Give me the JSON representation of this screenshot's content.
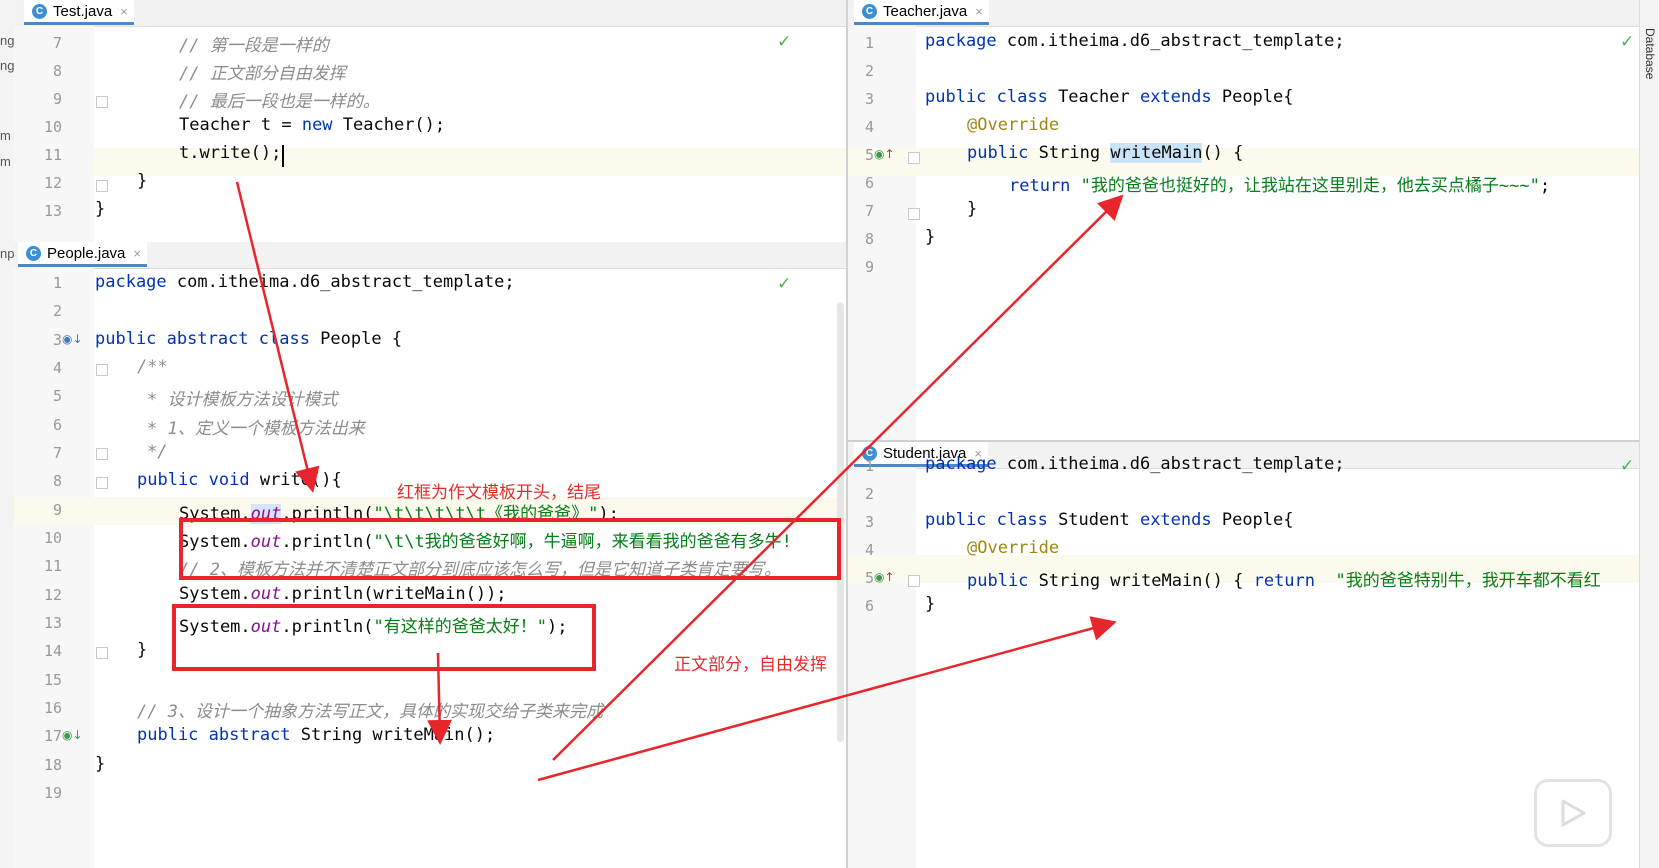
{
  "panes": {
    "test": {
      "tab_label": "Test.java",
      "close": "×",
      "lines": [
        {
          "n": "7",
          "text": "// 第一段是一样的"
        },
        {
          "n": "8",
          "text": "// 正文部分自由发挥"
        },
        {
          "n": "9",
          "text": "// 最后一段也是一样的。"
        },
        {
          "n": "10",
          "a": "Teacher t = ",
          "b": "new",
          "c": " Teacher();"
        },
        {
          "n": "11",
          "text": "t.write();"
        },
        {
          "n": "12",
          "text": "}"
        },
        {
          "n": "13",
          "text": "}"
        }
      ]
    },
    "people": {
      "tab_label": "People.java",
      "close": "×",
      "line_numbers": [
        "1",
        "2",
        "3",
        "4",
        "5",
        "6",
        "7",
        "8",
        "9",
        "10",
        "11",
        "12",
        "13",
        "14",
        "15",
        "16",
        "17",
        "18",
        "19"
      ],
      "l1_kw": "package",
      "l1_rest": " com.itheima.d6_abstract_template;",
      "l3_kw": "public abstract class",
      "l3_rest": " People {",
      "l4": "/**",
      "l5": "* 设计模板方法设计模式",
      "l6": "* 1、定义一个模板方法出来",
      "l7": "*/",
      "l8_kw": "public void",
      "l8_rest": " write(){",
      "sys": "System.",
      "out": "out",
      "l9_rest_a": ".println(",
      "l9_str": "\"\\t\\t\\t\\t\\t《我的爸爸》\"",
      "l9_end": ");",
      "l10_str": "\"\\t\\t我的爸爸好啊，牛逼啊，来看看我的爸爸有多牛!",
      "l11": "// 2、模板方法并不清楚正文部分到底应该怎么写，但是它知道子类肯定要写。",
      "l12_rest": ".println(writeMain());",
      "l13_str": "\"有这样的爸爸太好！\"",
      "l14": "}",
      "l16": "// 3、设计一个抽象方法写正文，具体的实现交给子类来完成",
      "l17_kw": "public abstract",
      "l17_rest": " String writeMain();",
      "l18": "}"
    },
    "teacher": {
      "tab_label": "Teacher.java",
      "close": "×",
      "line_numbers": [
        "1",
        "2",
        "3",
        "4",
        "5",
        "6",
        "7",
        "8",
        "9"
      ],
      "l1_kw": "package",
      "l1_rest": " com.itheima.d6_abstract_template;",
      "l3_kw1": "public class",
      "l3_mid": " Teacher ",
      "l3_kw2": "extends",
      "l3_rest": " People{",
      "l4": "@Override",
      "l5_kw": "public",
      "l5_mid": " String ",
      "l5_method": "writeMain",
      "l5_rest": "() {",
      "l6_kw": "return",
      "l6_str": "\"我的爸爸也挺好的，让我站在这里别走，他去买点橘子~~~\"",
      "l6_end": ";",
      "l7": "}",
      "l8": "}"
    },
    "student": {
      "tab_label": "Student.java",
      "close": "×",
      "line_numbers": [
        "1",
        "2",
        "3",
        "4",
        "5",
        "6"
      ],
      "l1_kw": "package",
      "l1_rest": " com.itheima.d6_abstract_template;",
      "l3_kw1": "public class",
      "l3_mid": " Student ",
      "l3_kw2": "extends",
      "l3_rest": " People{",
      "l4": "@Override",
      "l5_kw": "public",
      "l5_mid": " String writeMain() { ",
      "l5_kw2": "return",
      "l5_str": "\"我的爸爸特别牛，我开车都不看红",
      "l6": "}"
    }
  },
  "annotations": {
    "label_top": "红框为作文模板开头，结尾",
    "label_body": "正文部分，自由发挥"
  },
  "sidebar": {
    "database": "Database",
    "left_fragments": [
      "ng",
      "ng",
      "m",
      "m",
      "np"
    ]
  },
  "colors": {
    "annotation_red": "#e8252b",
    "keyword": "#0033b3",
    "string": "#067d17",
    "comment": "#8c8c8c"
  }
}
